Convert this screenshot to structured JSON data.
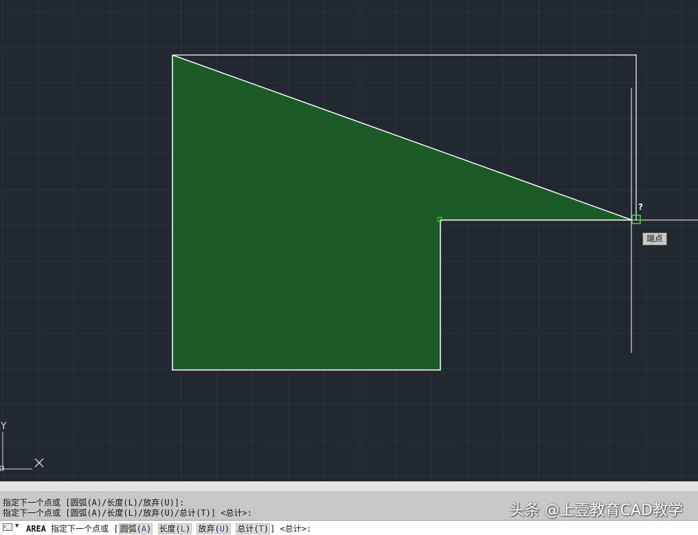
{
  "drawing": {
    "snap_tooltip": "端点",
    "cursor_glyph": "?",
    "ucs": {
      "y_label": "Y",
      "x_label": "✕"
    },
    "colors": {
      "background": "#212830",
      "grid": "#2c3540",
      "hatch_fill": "#1c5a27",
      "lines": "#ffffff",
      "snap_marker": "#3bdc3b"
    }
  },
  "command_line": {
    "history": [
      "指定下一个点或 [圆弧(A)/长度(L)/放弃(U)]:",
      "指定下一个点或 [圆弧(A)/长度(L)/放弃(U)/总计(T)] <总计>:"
    ],
    "prompt": {
      "command": "AREA",
      "text": "指定下一个点或 [",
      "options": [
        {
          "label": "圆弧(",
          "key": "A",
          "close": ")"
        },
        {
          "label": "长度(",
          "key": "L",
          "close": ")"
        },
        {
          "label": "放弃(",
          "key": "U",
          "close": ")"
        },
        {
          "label": "总计(",
          "key": "T",
          "close": ")"
        }
      ],
      "suffix": "] <总计>:"
    },
    "icon": "terminal-icon",
    "dropdown_icon": "triangle-down-icon"
  },
  "watermark": "头条 @上壹教育CAD教学"
}
